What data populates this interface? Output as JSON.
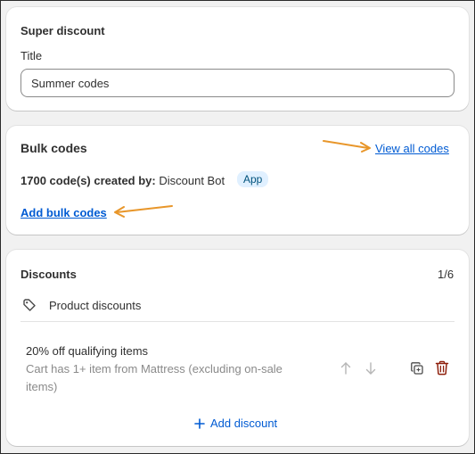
{
  "super_discount": {
    "heading": "Super discount",
    "title_label": "Title",
    "title_value": "Summer codes"
  },
  "bulk_codes": {
    "heading": "Bulk codes",
    "view_all_link": "View all codes",
    "created_by_label": "1700 code(s) created by:",
    "created_by_name": "Discount Bot",
    "badge": "App",
    "add_bulk_link": "Add bulk codes"
  },
  "discounts": {
    "heading": "Discounts",
    "count": "1/6",
    "group_label": "Product discounts",
    "item": {
      "title": "20% off qualifying items",
      "description_line1": "Cart has 1+ item from Mattress (excluding on-sale",
      "description_line2": "items)"
    },
    "add_discount_label": "Add discount"
  },
  "colors": {
    "link": "#005bd3",
    "annotation_arrow": "#e8962a",
    "delete_icon": "#8e1f0b",
    "badge_bg": "#e0f0ff"
  },
  "icons": [
    "tag-icon",
    "arrow-up-icon",
    "arrow-down-icon",
    "duplicate-icon",
    "delete-icon",
    "plus-icon"
  ]
}
